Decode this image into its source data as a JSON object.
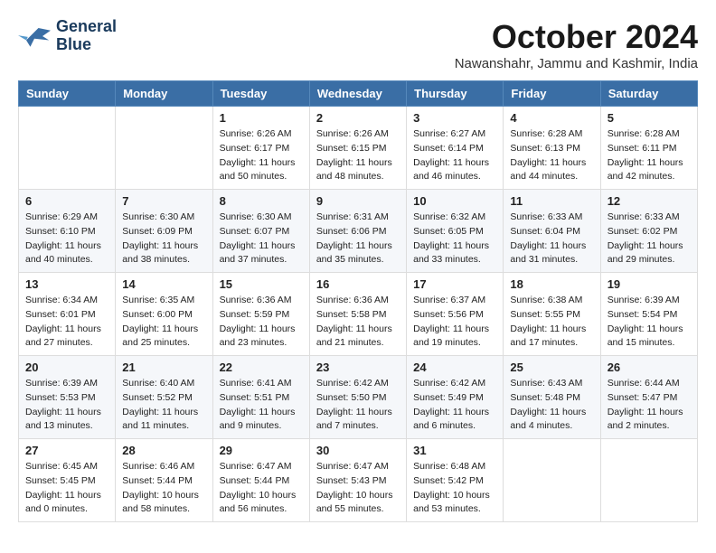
{
  "logo": {
    "line1": "General",
    "line2": "Blue"
  },
  "header": {
    "month": "October 2024",
    "location": "Nawanshahr, Jammu and Kashmir, India"
  },
  "weekdays": [
    "Sunday",
    "Monday",
    "Tuesday",
    "Wednesday",
    "Thursday",
    "Friday",
    "Saturday"
  ],
  "weeks": [
    [
      null,
      null,
      {
        "day": "1",
        "sunrise": "6:26 AM",
        "sunset": "6:17 PM",
        "daylight": "11 hours and 50 minutes."
      },
      {
        "day": "2",
        "sunrise": "6:26 AM",
        "sunset": "6:15 PM",
        "daylight": "11 hours and 48 minutes."
      },
      {
        "day": "3",
        "sunrise": "6:27 AM",
        "sunset": "6:14 PM",
        "daylight": "11 hours and 46 minutes."
      },
      {
        "day": "4",
        "sunrise": "6:28 AM",
        "sunset": "6:13 PM",
        "daylight": "11 hours and 44 minutes."
      },
      {
        "day": "5",
        "sunrise": "6:28 AM",
        "sunset": "6:11 PM",
        "daylight": "11 hours and 42 minutes."
      }
    ],
    [
      {
        "day": "6",
        "sunrise": "6:29 AM",
        "sunset": "6:10 PM",
        "daylight": "11 hours and 40 minutes."
      },
      {
        "day": "7",
        "sunrise": "6:30 AM",
        "sunset": "6:09 PM",
        "daylight": "11 hours and 38 minutes."
      },
      {
        "day": "8",
        "sunrise": "6:30 AM",
        "sunset": "6:07 PM",
        "daylight": "11 hours and 37 minutes."
      },
      {
        "day": "9",
        "sunrise": "6:31 AM",
        "sunset": "6:06 PM",
        "daylight": "11 hours and 35 minutes."
      },
      {
        "day": "10",
        "sunrise": "6:32 AM",
        "sunset": "6:05 PM",
        "daylight": "11 hours and 33 minutes."
      },
      {
        "day": "11",
        "sunrise": "6:33 AM",
        "sunset": "6:04 PM",
        "daylight": "11 hours and 31 minutes."
      },
      {
        "day": "12",
        "sunrise": "6:33 AM",
        "sunset": "6:02 PM",
        "daylight": "11 hours and 29 minutes."
      }
    ],
    [
      {
        "day": "13",
        "sunrise": "6:34 AM",
        "sunset": "6:01 PM",
        "daylight": "11 hours and 27 minutes."
      },
      {
        "day": "14",
        "sunrise": "6:35 AM",
        "sunset": "6:00 PM",
        "daylight": "11 hours and 25 minutes."
      },
      {
        "day": "15",
        "sunrise": "6:36 AM",
        "sunset": "5:59 PM",
        "daylight": "11 hours and 23 minutes."
      },
      {
        "day": "16",
        "sunrise": "6:36 AM",
        "sunset": "5:58 PM",
        "daylight": "11 hours and 21 minutes."
      },
      {
        "day": "17",
        "sunrise": "6:37 AM",
        "sunset": "5:56 PM",
        "daylight": "11 hours and 19 minutes."
      },
      {
        "day": "18",
        "sunrise": "6:38 AM",
        "sunset": "5:55 PM",
        "daylight": "11 hours and 17 minutes."
      },
      {
        "day": "19",
        "sunrise": "6:39 AM",
        "sunset": "5:54 PM",
        "daylight": "11 hours and 15 minutes."
      }
    ],
    [
      {
        "day": "20",
        "sunrise": "6:39 AM",
        "sunset": "5:53 PM",
        "daylight": "11 hours and 13 minutes."
      },
      {
        "day": "21",
        "sunrise": "6:40 AM",
        "sunset": "5:52 PM",
        "daylight": "11 hours and 11 minutes."
      },
      {
        "day": "22",
        "sunrise": "6:41 AM",
        "sunset": "5:51 PM",
        "daylight": "11 hours and 9 minutes."
      },
      {
        "day": "23",
        "sunrise": "6:42 AM",
        "sunset": "5:50 PM",
        "daylight": "11 hours and 7 minutes."
      },
      {
        "day": "24",
        "sunrise": "6:42 AM",
        "sunset": "5:49 PM",
        "daylight": "11 hours and 6 minutes."
      },
      {
        "day": "25",
        "sunrise": "6:43 AM",
        "sunset": "5:48 PM",
        "daylight": "11 hours and 4 minutes."
      },
      {
        "day": "26",
        "sunrise": "6:44 AM",
        "sunset": "5:47 PM",
        "daylight": "11 hours and 2 minutes."
      }
    ],
    [
      {
        "day": "27",
        "sunrise": "6:45 AM",
        "sunset": "5:45 PM",
        "daylight": "11 hours and 0 minutes."
      },
      {
        "day": "28",
        "sunrise": "6:46 AM",
        "sunset": "5:44 PM",
        "daylight": "10 hours and 58 minutes."
      },
      {
        "day": "29",
        "sunrise": "6:47 AM",
        "sunset": "5:44 PM",
        "daylight": "10 hours and 56 minutes."
      },
      {
        "day": "30",
        "sunrise": "6:47 AM",
        "sunset": "5:43 PM",
        "daylight": "10 hours and 55 minutes."
      },
      {
        "day": "31",
        "sunrise": "6:48 AM",
        "sunset": "5:42 PM",
        "daylight": "10 hours and 53 minutes."
      },
      null,
      null
    ]
  ]
}
